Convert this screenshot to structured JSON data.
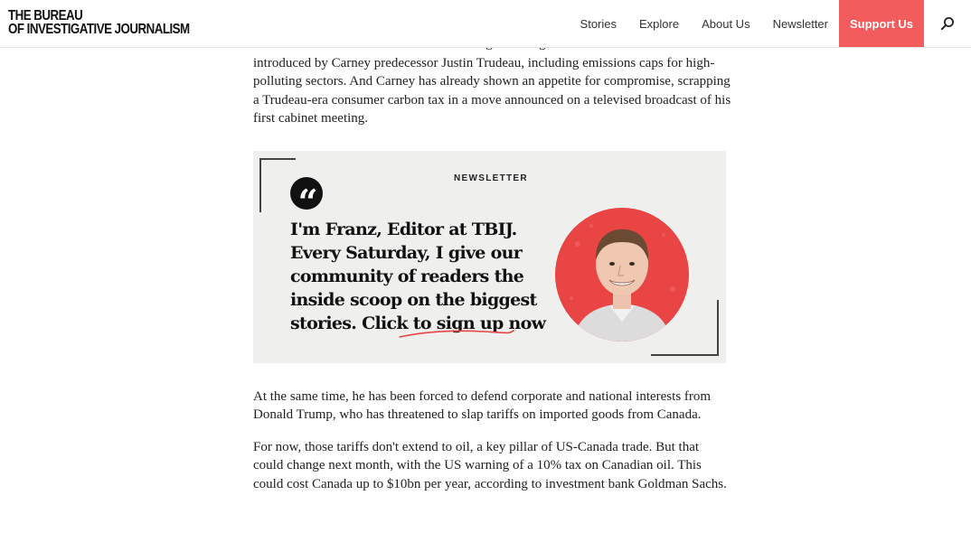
{
  "header": {
    "logo_line1": "THE BUREAU",
    "logo_line2": "OF INVESTIGATIVE JOURNALISM",
    "nav": [
      "Stories",
      "Explore",
      "About Us",
      "Newsletter"
    ],
    "support_label": "Support Us",
    "support_color": "#f25c5c"
  },
  "article": {
    "partial_top": "Canada's Conservatives have often railed against tougher environmental rules",
    "para1": "introduced by Carney predecessor Justin Trudeau, including emissions caps for high-polluting sectors. And Carney has already shown an appetite for compromise, scrapping a Trudeau-era consumer carbon tax in a move announced on a televised broadcast of his first cabinet meeting.",
    "para2": "At the same time, he has been forced to defend corporate and national interests from Donald Trump, who has threatened to slap tariffs on imported goods from Canada.",
    "para3": "For now, those tariffs don't extend to oil, a key pillar of US-Canada trade. But that could change next month, with the US warning of a 10% tax on Canadian oil. This could cost Canada up to $10bn per year, according to investment bank Goldman Sachs."
  },
  "promo": {
    "label": "NEWSLETTER",
    "quote_mark": "“",
    "headline": "I'm Franz, Editor at TBIJ. Every Saturday, I give our community of readers the inside scoop on the biggest stories. Click to sign up now",
    "accent": "#e94545"
  }
}
